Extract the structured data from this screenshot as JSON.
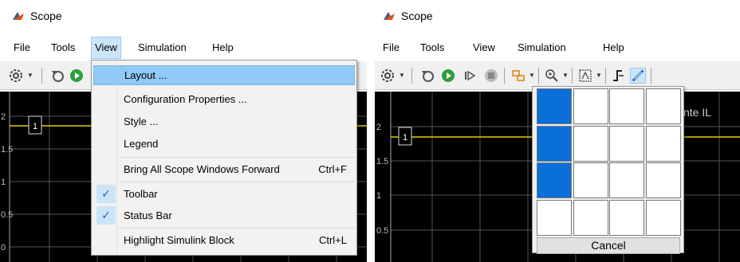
{
  "left": {
    "window_title": "Scope",
    "menu": [
      "File",
      "Tools",
      "View",
      "Simulation",
      "Help"
    ],
    "open_menu": "View",
    "view_menu": {
      "items": [
        {
          "label": "Layout ...",
          "shortcut": "",
          "checked": false,
          "highlighted": true
        },
        {
          "label": "Configuration Properties ...",
          "shortcut": "",
          "checked": false,
          "highlighted": false
        },
        {
          "label": "Style ...",
          "shortcut": "",
          "checked": false,
          "highlighted": false
        },
        {
          "label": "Legend",
          "shortcut": "",
          "checked": false,
          "highlighted": false
        },
        {
          "label": "Bring All Scope Windows Forward",
          "shortcut": "Ctrl+F",
          "checked": false,
          "highlighted": false
        },
        {
          "label": "Toolbar",
          "shortcut": "",
          "checked": true,
          "highlighted": false
        },
        {
          "label": "Status Bar",
          "shortcut": "",
          "checked": true,
          "highlighted": false
        },
        {
          "label": "Highlight Simulink Block",
          "shortcut": "Ctrl+L",
          "checked": false,
          "highlighted": false
        }
      ]
    },
    "plot": {
      "y_ticks": [
        "2",
        "1.5",
        "1",
        "0.5",
        "0"
      ],
      "signal_label": "1"
    }
  },
  "right": {
    "window_title": "Scope",
    "menu": [
      "File",
      "Tools",
      "View",
      "Simulation",
      "Help"
    ],
    "plot": {
      "y_ticks": [
        "2",
        "1.5",
        "1",
        "0.5"
      ],
      "signal_label": "1",
      "title_fragment": "nte IL"
    },
    "layout_popup": {
      "rows": 4,
      "cols": 4,
      "selected_rows": 3,
      "selected_cols": 1,
      "cancel_label": "Cancel"
    }
  },
  "colors": {
    "accent": "#0a6fd8",
    "menu_highlight": "#91c9f7",
    "plot_bg": "#000000",
    "signal": "#e0d000"
  }
}
